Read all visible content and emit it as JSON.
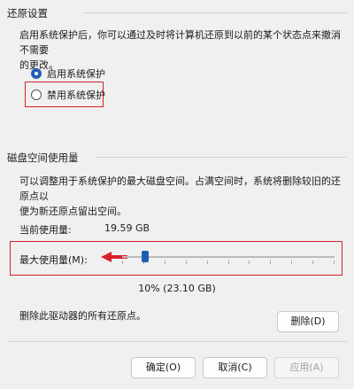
{
  "restore": {
    "title": "还原设置",
    "description_line1": "启用系统保护后，你可以通过及时将计算机还原到以前的某个状态点来撤消不需要",
    "description_line2": "的更改。",
    "options": [
      {
        "label": "启用系统保护",
        "checked": true
      },
      {
        "label": "禁用系统保护",
        "checked": false
      }
    ]
  },
  "disk": {
    "title": "磁盘空间使用量",
    "description_line1": "可以调整用于系统保护的最大磁盘空间。占满空间时，系统将删除较旧的还原点以",
    "description_line2": "便为新还原点留出空间。",
    "current_label": "当前使用量:",
    "current_value": "19.59 GB",
    "max_label": "最大使用量(M):",
    "slider_value": 0.1,
    "slider_text": "10% (23.10 GB)",
    "delete_desc": "删除此驱动器的所有还原点。",
    "delete_button": "删除(D)"
  },
  "footer": {
    "ok": "确定(O)",
    "cancel": "取消(C)",
    "apply": "应用(A)"
  },
  "colors": {
    "accent": "#1f5fb3",
    "highlight": "#d6202a"
  }
}
